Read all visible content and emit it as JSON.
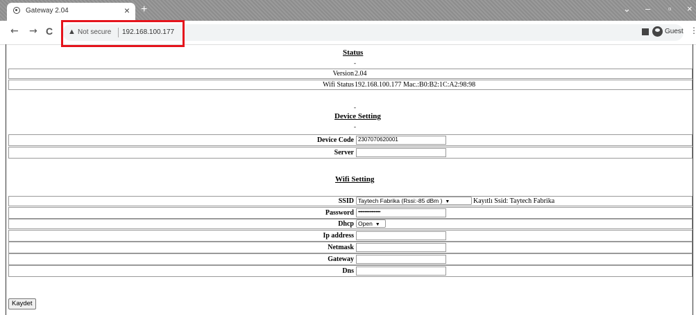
{
  "browser": {
    "tab_title": "Gateway 2.04",
    "tab_close": "×",
    "new_tab": "+",
    "window_controls": [
      "⌄",
      "–",
      "▫",
      "×"
    ],
    "nav": {
      "back": "←",
      "forward": "→",
      "reload": "C"
    },
    "security_label": "Not secure",
    "url": "192.168.100.177",
    "profile_label": "Guest",
    "menu": "⋮",
    "highlight_color": "#e5141c"
  },
  "status": {
    "heading": "Status",
    "dash": "-",
    "rows": [
      {
        "label": "Version",
        "value": "2.04"
      },
      {
        "label": "Wifi Status",
        "value": "192.168.100.177 Mac.:B0:B2:1C:A2:98:98"
      }
    ]
  },
  "device_setting": {
    "heading": "Device Setting",
    "dash_top": "-",
    "dash_bottom": "-",
    "rows": [
      {
        "label": "Device Code",
        "value": "2307070620001"
      },
      {
        "label": "Server",
        "value": ""
      }
    ]
  },
  "wifi_setting": {
    "heading": "Wifi Setting",
    "ssid_label": "SSID",
    "ssid_selected": "Taytech Fabrika (Rssi:-85 dBm )",
    "ssid_note": "Kayıtlı Ssid: Taytech Fabrika",
    "password_label": "Password",
    "password_value": "••••••••••••••••••••",
    "dhcp_label": "Dhcp",
    "dhcp_selected": "Open",
    "ip_label": "Ip address",
    "ip_value": "",
    "netmask_label": "Netmask",
    "netmask_value": "",
    "gateway_label": "Gateway",
    "gateway_value": "",
    "dns_label": "Dns",
    "dns_value": ""
  },
  "save_button": "Kaydet"
}
